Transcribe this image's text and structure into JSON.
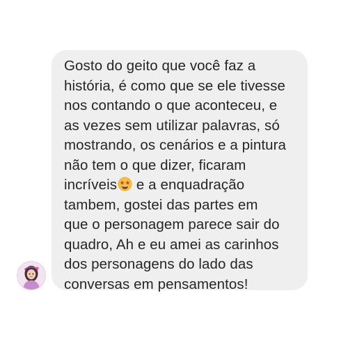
{
  "conversation": {
    "message": {
      "lines": [
        "Gosto do geito que você faz a",
        "história, é como que se ele tivesse",
        "nos contando o que aconteceu, e",
        "as vezes sem utilizar palavras, só",
        "mostrando, os cenários e a pintura",
        "não tem o que dizer, ficaram",
        "incríveis",
        "tambem, gostei das partes em",
        "que o personagem parece sair do",
        "quadro, Ah e eu amei as carinhos",
        "dos personagens do lado das",
        "conversas em pensamentos!"
      ],
      "line7_after_emoji": " e a enquadração",
      "emoji": "star-struck-emoji"
    },
    "avatar": "sender-avatar-icon"
  },
  "colors": {
    "background": "#ffffff",
    "bubble": "#efefef",
    "text": "#262626",
    "emoji_face": "#f7c33c",
    "emoji_star": "#e8354a"
  }
}
